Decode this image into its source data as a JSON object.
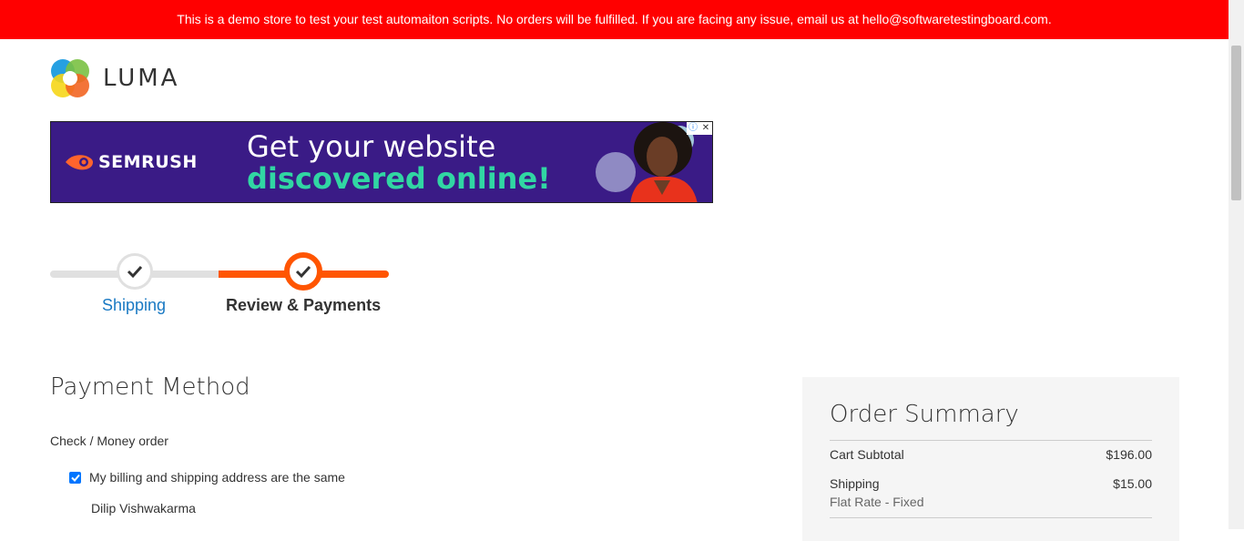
{
  "demo_notice": "This is a demo store to test your test automaiton scripts. No orders will be fulfilled. If you are facing any issue, email us at hello@softwaretestingboard.com.",
  "logo": {
    "text": "LUMA"
  },
  "ad": {
    "brand": "SEMRUSH",
    "headline_line1": "Get your website",
    "headline_line2": "discovered online!",
    "adchoices_icon": "info-icon",
    "close_icon": "close-icon",
    "colors": {
      "background": "#3a1b86",
      "accent": "#31d6a3",
      "brand": "#ff642d"
    }
  },
  "progress": {
    "steps": [
      {
        "label": "Shipping",
        "state": "complete"
      },
      {
        "label": "Review & Payments",
        "state": "current"
      }
    ],
    "colors": {
      "active": "#ff5501",
      "inactive": "#e0e0e0",
      "link": "#1979c3"
    }
  },
  "payment": {
    "title": "Payment Method",
    "method": "Check / Money order",
    "billing_same_label": "My billing and shipping address are the same",
    "billing_same_checked": true,
    "customer_name": "Dilip Vishwakarma"
  },
  "summary": {
    "title": "Order Summary",
    "cart_subtotal_label": "Cart Subtotal",
    "cart_subtotal_value": "$196.00",
    "shipping_label": "Shipping",
    "shipping_value": "$15.00",
    "shipping_method": "Flat Rate - Fixed"
  }
}
